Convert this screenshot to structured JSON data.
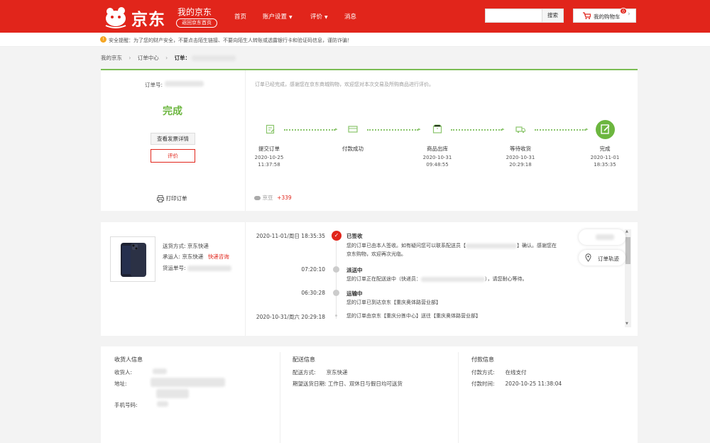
{
  "header": {
    "logo_text": "京东",
    "my_jd": "我的京东",
    "home_btn": "返回京东首页",
    "nav": [
      {
        "label": "首页",
        "dropdown": false
      },
      {
        "label": "账户设置",
        "dropdown": true
      },
      {
        "label": "评价",
        "dropdown": true
      },
      {
        "label": "消息",
        "dropdown": false
      }
    ],
    "search_btn": "搜索",
    "cart_label": "我的购物车",
    "cart_count": "0",
    "brand_color": "#e1251b"
  },
  "notice": {
    "text": "安全提醒：为了您的财产安全，不要点击陌生链接、不要向陌生人转账或透露银行卡和验证码信息，谨防诈骗！"
  },
  "breadcrumb": {
    "items": [
      "我的京东",
      "订单中心"
    ],
    "current": "订单："
  },
  "order": {
    "order_no_label": "订单号:",
    "status": "完成",
    "status_tip": "订单已经完成，感谢您在京东商城购物，欢迎您对本次交易及所购商品进行评价。",
    "invoice_btn": "查看发票详情",
    "review_btn": "评价",
    "print": "打印订单",
    "jd_bean_label": "京豆",
    "jd_bean_value": "+339",
    "steps": [
      {
        "label": "提交订单",
        "date": "2020-10-25",
        "time": "11:37:58"
      },
      {
        "label": "付款成功",
        "date": "",
        "time": ""
      },
      {
        "label": "商品出库",
        "date": "2020-10-31",
        "time": "09:48:55"
      },
      {
        "label": "等待收货",
        "date": "2020-10-31",
        "time": "20:29:18"
      },
      {
        "label": "完成",
        "date": "2020-11-01",
        "time": "18:35:35"
      }
    ]
  },
  "shipping": {
    "method_label": "送货方式:",
    "method": "京东快递",
    "carrier_label": "承运人:",
    "carrier": "京东快递",
    "carrier_link": "快递咨询",
    "tracking_label": "货运单号:",
    "track": [
      {
        "time": "2020-11-01/周日  18:35:35",
        "title": "已签收",
        "desc1": "您的订单已由本人签收。如有疑问您可以联系配送员【",
        "desc1b": "】确认。感谢您在",
        "desc2": "京东购物，欢迎再次光临。"
      },
      {
        "time": "07:20:10",
        "title": "派送中",
        "desc1": "您的订单正在配送途中（快递员：",
        "desc1b": "），请您耐心等待。",
        "desc2": ""
      },
      {
        "time": "06:30:28",
        "title": "运输中",
        "desc1": "您的订单已到达京东【重庆奥体路营业部】",
        "desc1b": "",
        "desc2": ""
      },
      {
        "time": "2020-10-31/周六  20:29:18",
        "title": "",
        "desc1": "您的订单由京东【重庆分拣中心】送往【重庆奥体路营业部】",
        "desc1b": "",
        "desc2": ""
      }
    ],
    "float_track_btn": "订单轨迹"
  },
  "info": {
    "receiver_title": "收货人信息",
    "receiver_label": "收货人:",
    "address_label": "地址:",
    "phone_label": "手机号码:",
    "delivery_title": "配送信息",
    "delivery_method_label": "配送方式:",
    "delivery_method": "京东快递",
    "delivery_date_label": "期望送货日期:",
    "delivery_date": "工作日、双休日与假日均可送货",
    "payment_title": "付款信息",
    "payment_method_label": "付款方式:",
    "payment_method": "在线支付",
    "payment_time_label": "付款时间:",
    "payment_time": "2020-10-25 11:38:04"
  }
}
